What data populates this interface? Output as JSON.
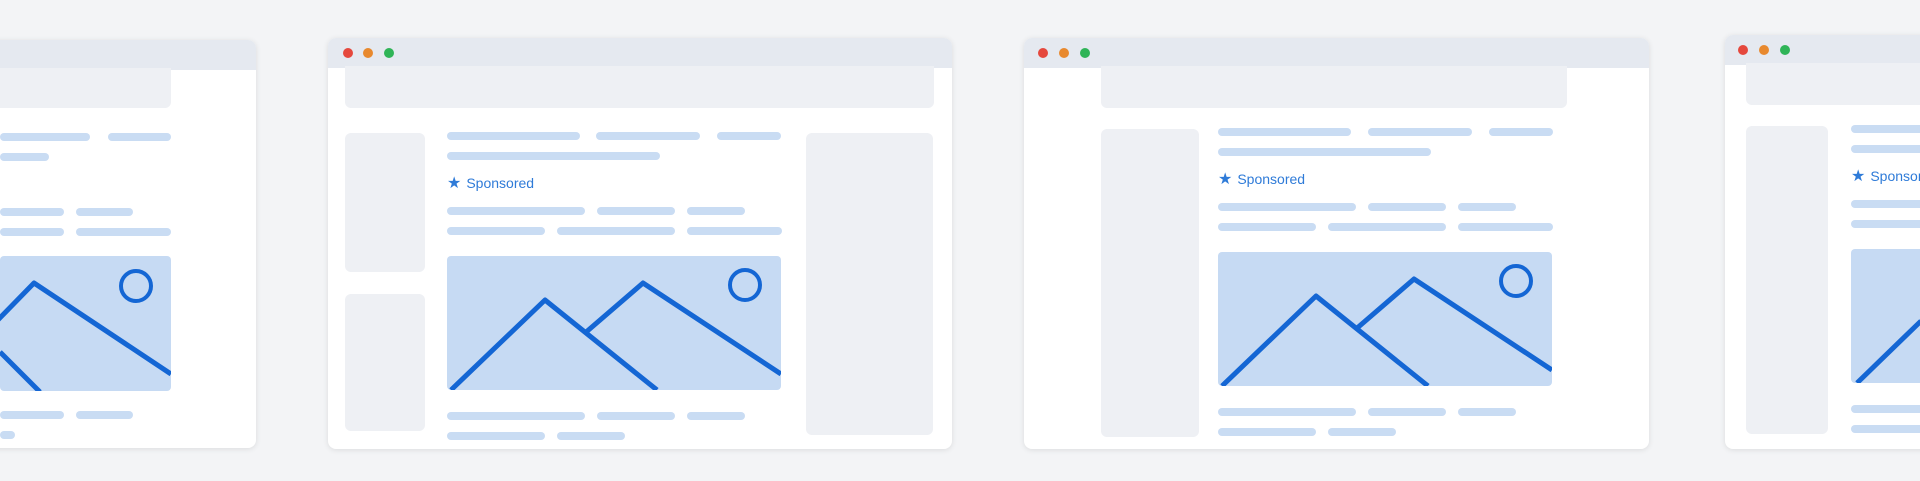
{
  "sponsored": {
    "label": "Sponsored",
    "icon": "star-icon"
  },
  "colors": {
    "background": "#f3f4f6",
    "window": "#ffffff",
    "titlebar": "#e5e9f0",
    "placeholder_block": "#eef0f4",
    "placeholder_line": "#c9dcf3",
    "image_fill": "#c6daf3",
    "accent": "#1466d4",
    "traffic_red": "#e5483d",
    "traffic_orange": "#e8892e",
    "traffic_green": "#2fb457"
  }
}
